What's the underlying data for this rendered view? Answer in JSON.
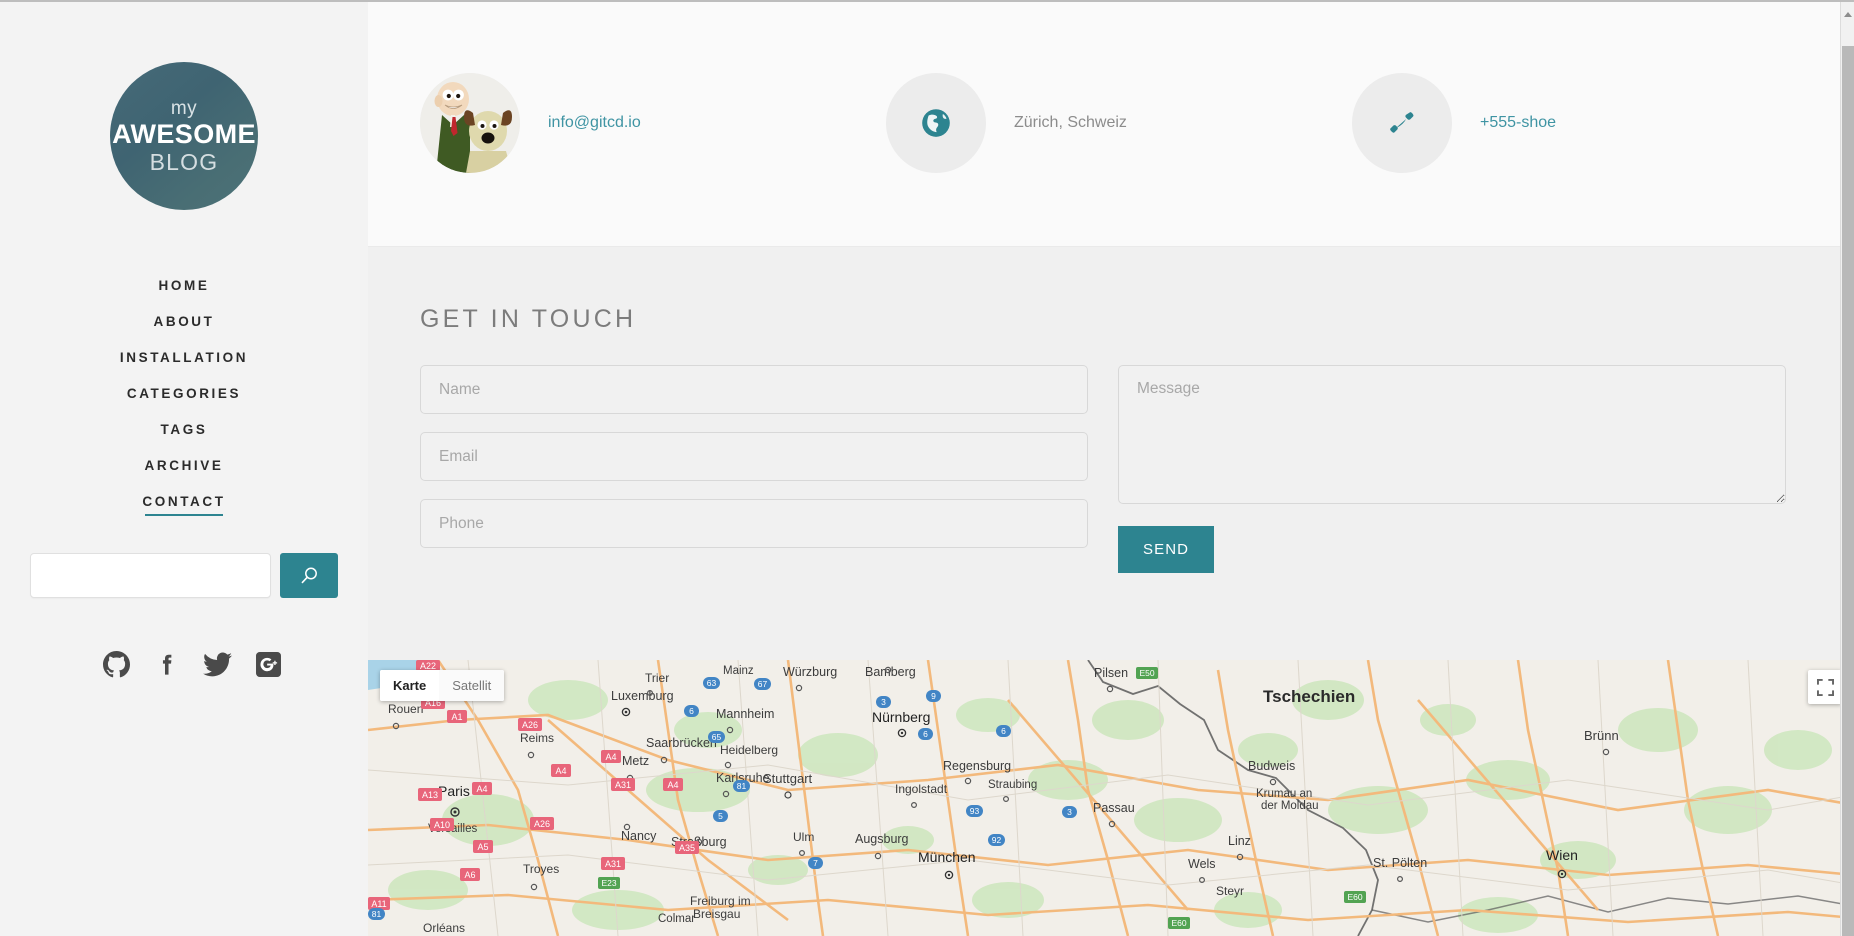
{
  "brand": {
    "line1": "my",
    "line2": "AWESOME",
    "line3": "BLOG"
  },
  "colors": {
    "accent_teal": "#2d8490",
    "sidebar_bg": "#f3f3f3",
    "card_bg": "#fafafa",
    "link_teal": "#3f94a3",
    "text_gray": "#8c8c8c"
  },
  "sidebar": {
    "menu": [
      {
        "label": "HOME",
        "active": false
      },
      {
        "label": "ABOUT",
        "active": false
      },
      {
        "label": "INSTALLATION",
        "active": false
      },
      {
        "label": "CATEGORIES",
        "active": false
      },
      {
        "label": "TAGS",
        "active": false
      },
      {
        "label": "ARCHIVE",
        "active": false
      },
      {
        "label": "CONTACT",
        "active": true
      }
    ],
    "search": {
      "value": "",
      "placeholder": "",
      "icon": "search-icon"
    },
    "social": [
      {
        "name": "github-icon"
      },
      {
        "name": "facebook-icon"
      },
      {
        "name": "twitter-icon"
      },
      {
        "name": "google-plus-icon"
      }
    ]
  },
  "contact_bar": [
    {
      "icon": "avatar-image",
      "text": "info@gitcd.io",
      "style": "link"
    },
    {
      "icon": "globe-icon",
      "text": "Zürich, Schweiz",
      "style": "plain"
    },
    {
      "icon": "phone-icon",
      "text": "+555-shoe",
      "style": "link"
    }
  ],
  "form": {
    "title": "GET IN TOUCH",
    "name": {
      "value": "",
      "placeholder": "Name"
    },
    "email": {
      "value": "",
      "placeholder": "Email"
    },
    "phone": {
      "value": "",
      "placeholder": "Phone"
    },
    "message": {
      "value": "",
      "placeholder": "Message"
    },
    "send_label": "SEND"
  },
  "map": {
    "type_buttons": [
      {
        "label": "Karte",
        "active": true
      },
      {
        "label": "Satellit",
        "active": false
      }
    ],
    "fullscreen_icon": "fullscreen-icon",
    "country_labels": [
      "Tschechien"
    ],
    "cities": [
      "Rouen",
      "Paris",
      "Versailles",
      "Reims",
      "Troyes",
      "Orléans",
      "Luxemburg",
      "Trier",
      "Metz",
      "Nancy",
      "Saarbrücken",
      "Straßburg",
      "Colmar",
      "Freiburg im Breisgau",
      "Mainz",
      "Mannheim",
      "Heidelberg",
      "Karlsruhe",
      "Stuttgart",
      "Ulm",
      "Augsburg",
      "München",
      "Würzburg",
      "Bamberg",
      "Nürnberg",
      "Regensburg",
      "Straubing",
      "Ingolstadt",
      "Passau",
      "Pilsen",
      "Budweis",
      "Krumau an der Moldau",
      "Linz",
      "Wels",
      "Steyr",
      "St. Pölten",
      "Wien",
      "Brünn"
    ],
    "road_shields_red": [
      "A16",
      "A1",
      "A13",
      "A10",
      "A5",
      "A6",
      "A11",
      "A26",
      "A26",
      "A4",
      "A4",
      "A4",
      "A31",
      "A31",
      "A35",
      "A22"
    ],
    "road_shields_blue": [
      "63",
      "67",
      "6",
      "65",
      "5",
      "81",
      "3",
      "9",
      "6",
      "93",
      "92",
      "7",
      "3",
      "81"
    ],
    "road_shields_green": [
      "E23",
      "E50",
      "E60",
      "E60"
    ]
  }
}
